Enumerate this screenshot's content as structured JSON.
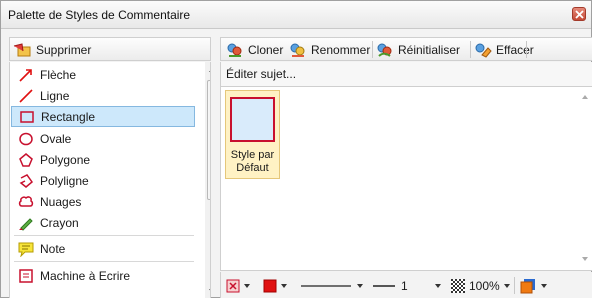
{
  "window": {
    "title": "Palette de Styles de Commentaire"
  },
  "left_toolbar": {
    "delete_label": "Supprimer"
  },
  "tools": [
    {
      "label": "Flèche",
      "icon": "arrow-icon"
    },
    {
      "label": "Ligne",
      "icon": "line-icon"
    },
    {
      "label": "Rectangle",
      "icon": "rectangle-icon",
      "selected": true
    },
    {
      "label": "Ovale",
      "icon": "oval-icon"
    },
    {
      "label": "Polygone",
      "icon": "polygon-icon"
    },
    {
      "label": "Polyligne",
      "icon": "polyline-icon"
    },
    {
      "label": "Nuages",
      "icon": "cloud-icon"
    },
    {
      "label": "Crayon",
      "icon": "pencil-icon"
    },
    {
      "label": "Note",
      "icon": "note-icon"
    },
    {
      "label": "Machine à Ecrire",
      "icon": "typewriter-icon"
    }
  ],
  "right_toolbar": {
    "clone_label": "Cloner",
    "rename_label": "Renommer",
    "reset_label": "Réinitialiser",
    "erase_label": "Effacer"
  },
  "edit_subject_label": "Éditer sujet...",
  "styles": [
    {
      "caption_line1": "Style par",
      "caption_line2": "Défaut"
    }
  ],
  "bottom_toolbar": {
    "line_width": "1",
    "opacity": "100%"
  },
  "colors": {
    "accent_red": "#e01010",
    "selection": "#cde8fb",
    "tile_bg": "#fff2c4",
    "orange": "#f07a12"
  }
}
